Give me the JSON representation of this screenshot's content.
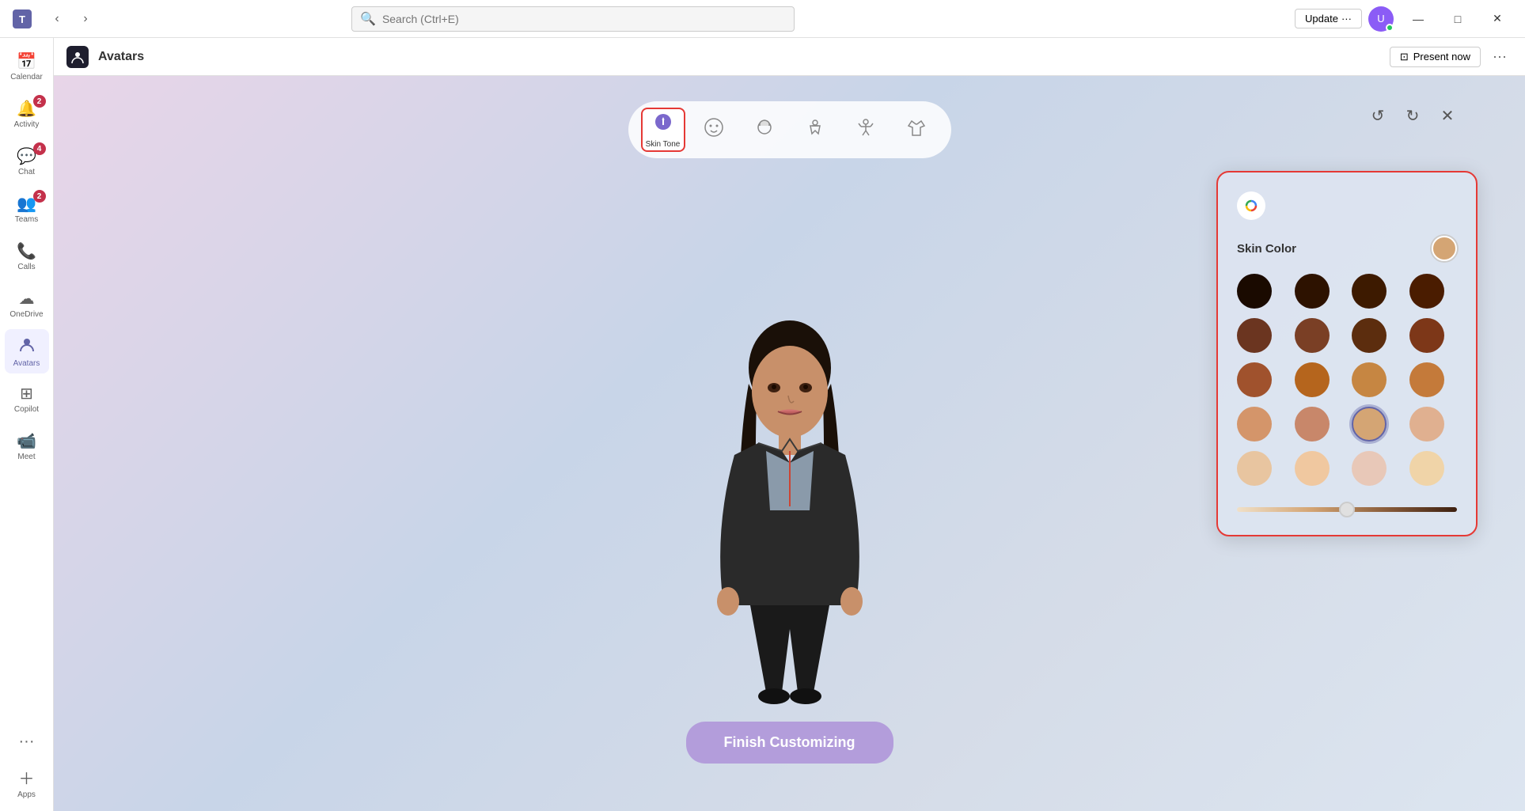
{
  "titlebar": {
    "search_placeholder": "Search (Ctrl+E)",
    "update_label": "Update",
    "more_label": "···",
    "minimize": "—",
    "maximize": "□",
    "close": "✕"
  },
  "sidebar": {
    "items": [
      {
        "id": "calendar",
        "label": "Calendar",
        "icon": "📅",
        "badge": null,
        "active": false
      },
      {
        "id": "activity",
        "label": "Activity",
        "icon": "🔔",
        "badge": "2",
        "active": false
      },
      {
        "id": "chat",
        "label": "Chat",
        "icon": "💬",
        "badge": "4",
        "active": false
      },
      {
        "id": "teams",
        "label": "Teams",
        "icon": "👥",
        "badge": "2",
        "active": false
      },
      {
        "id": "calls",
        "label": "Calls",
        "icon": "📞",
        "badge": null,
        "active": false
      },
      {
        "id": "onedrive",
        "label": "OneDrive",
        "icon": "☁",
        "badge": null,
        "active": false
      },
      {
        "id": "avatars",
        "label": "Avatars",
        "icon": "🧑",
        "badge": null,
        "active": true
      },
      {
        "id": "copilot",
        "label": "Copilot",
        "icon": "⊞",
        "badge": null,
        "active": false
      },
      {
        "id": "meet",
        "label": "Meet",
        "icon": "📹",
        "badge": null,
        "active": false
      },
      {
        "id": "apps",
        "label": "Apps",
        "icon": "＋",
        "badge": null,
        "active": false
      }
    ],
    "more_label": "···"
  },
  "app_header": {
    "icon": "🧑",
    "title": "Avatars",
    "present_now": "Present now",
    "more": "···"
  },
  "toolbar": {
    "tools": [
      {
        "id": "skin-tone",
        "icon": "🎨",
        "label": "Skin Tone",
        "active": true
      },
      {
        "id": "face",
        "icon": "😊",
        "label": "",
        "active": false
      },
      {
        "id": "hair",
        "icon": "💇",
        "label": "",
        "active": false
      },
      {
        "id": "body",
        "icon": "👤",
        "label": "",
        "active": false
      },
      {
        "id": "pose",
        "icon": "🙆",
        "label": "",
        "active": false
      },
      {
        "id": "outfit",
        "icon": "👕",
        "label": "",
        "active": false
      }
    ]
  },
  "canvas_controls": {
    "undo": "↺",
    "redo": "↻",
    "close": "✕"
  },
  "skin_panel": {
    "title": "Skin Color",
    "colors": [
      {
        "row": 1,
        "swatches": [
          "#1a0a00",
          "#2d1200",
          "#3d1a00",
          "#4a1c00"
        ]
      },
      {
        "row": 2,
        "swatches": [
          "#6b3520",
          "#7a3f25",
          "#5c2d0e",
          "#7d3718"
        ]
      },
      {
        "row": 3,
        "swatches": [
          "#a0522d",
          "#b5651d",
          "#c68642",
          "#c47a3a"
        ]
      },
      {
        "row": 4,
        "swatches": [
          "#d4956a",
          "#c8876a",
          "#d4a574",
          "#e0b090"
        ]
      },
      {
        "row": 5,
        "swatches": [
          "#e8c5a0",
          "#f0c8a0",
          "#e8c8b8",
          "#f0d4a8"
        ]
      }
    ],
    "selected_color": "#d4a574",
    "slider_value": 50
  },
  "finish_btn": "Finish Customizing"
}
